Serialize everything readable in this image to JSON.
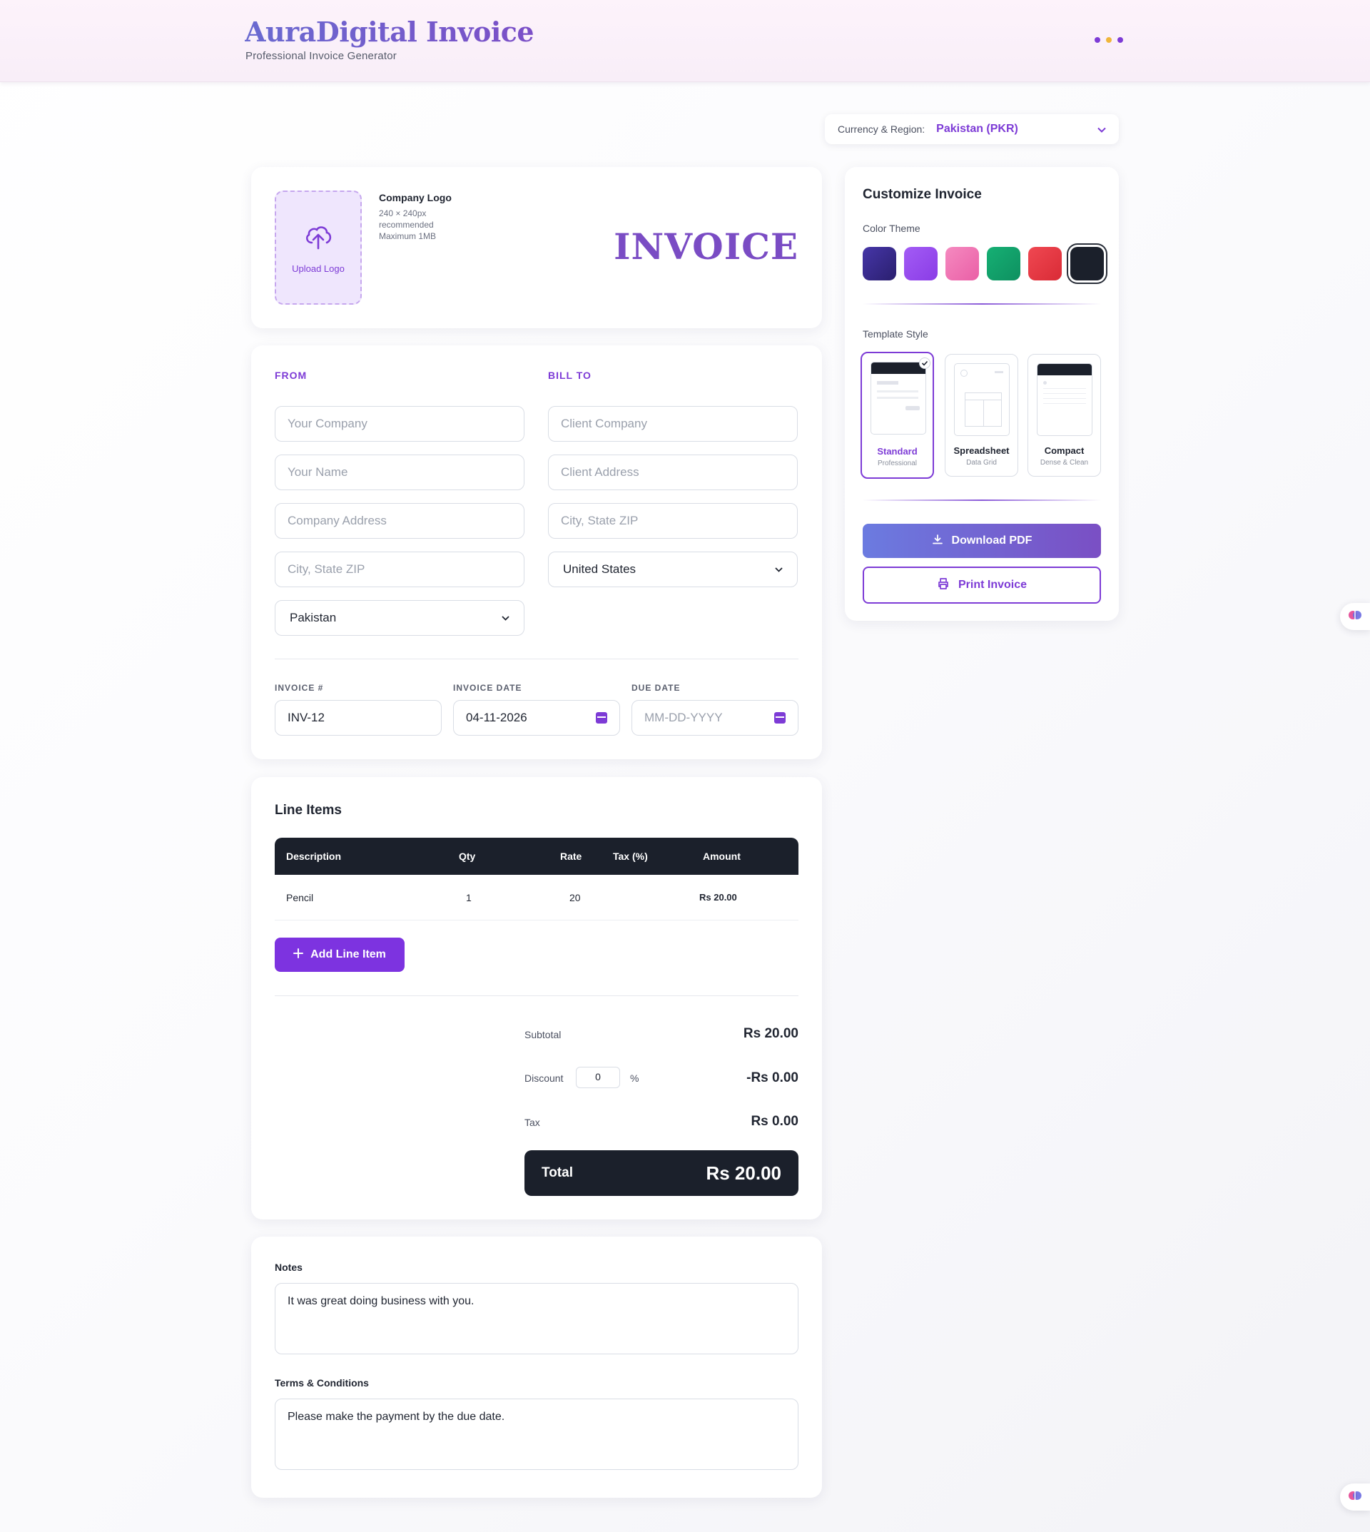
{
  "colors": {
    "accent": "#7d3bd6",
    "dark": "#1b202b",
    "theme_swatches": [
      "#3b2d8f",
      "#9b4ff0",
      "#f27ab8",
      "#12a06a",
      "#e83a45",
      "#1b202b"
    ],
    "header_dots": [
      "#7d3bd6",
      "#f0b63a",
      "#7d3bd6"
    ]
  },
  "header": {
    "title": "AuraDigital Invoice",
    "subtitle": "Professional Invoice Generator",
    "menu_icon": "ellipsis-icon"
  },
  "currency": {
    "label": "Currency & Region:",
    "value": "Pakistan (PKR)"
  },
  "logo": {
    "upload_label": "Upload Logo",
    "title": "Company Logo",
    "size": "240 × 240px",
    "hint": "recommended",
    "max": "Maximum 1MB",
    "invoice_word": "INVOICE"
  },
  "from": {
    "label": "FROM",
    "company_placeholder": "Your Company",
    "name_placeholder": "Your Name",
    "address_placeholder": "Company Address",
    "city_placeholder": "City, State ZIP",
    "country": "Pakistan"
  },
  "bill_to": {
    "label": "BILL TO",
    "company_placeholder": "Client Company",
    "address_placeholder": "Client Address",
    "city_placeholder": "City, State ZIP",
    "country": "United States"
  },
  "meta": {
    "invoice_no_label": "INVOICE #",
    "invoice_no": "INV-12",
    "date_label": "INVOICE DATE",
    "date": "04-11-2026",
    "due_label": "DUE DATE",
    "due_placeholder": "MM-DD-YYYY"
  },
  "line_items": {
    "title": "Line Items",
    "columns": [
      "Description",
      "Qty",
      "Rate",
      "Tax (%)",
      "Amount"
    ],
    "rows": [
      {
        "description": "Pencil",
        "qty": "1",
        "rate": "20",
        "tax": "",
        "amount": "Rs 20.00"
      }
    ],
    "add_label": "Add Line Item"
  },
  "totals": {
    "subtotal_label": "Subtotal",
    "subtotal": "Rs 20.00",
    "discount_label": "Discount",
    "discount_value": "0",
    "discount_unit": "%",
    "discount": "-Rs 0.00",
    "tax_label": "Tax",
    "tax": "Rs 0.00",
    "total_label": "Total",
    "total": "Rs 20.00"
  },
  "notes": {
    "notes_label": "Notes",
    "notes": "It was great doing business with you.",
    "terms_label": "Terms & Conditions",
    "terms": "Please make the payment by the due date."
  },
  "customize": {
    "title": "Customize Invoice",
    "color_label": "Color Theme",
    "template_label": "Template Style",
    "templates": [
      {
        "name": "Standard",
        "desc": "Professional"
      },
      {
        "name": "Spreadsheet",
        "desc": "Data Grid"
      },
      {
        "name": "Compact",
        "desc": "Dense & Clean"
      }
    ],
    "download_label": "Download PDF",
    "print_label": "Print Invoice"
  }
}
